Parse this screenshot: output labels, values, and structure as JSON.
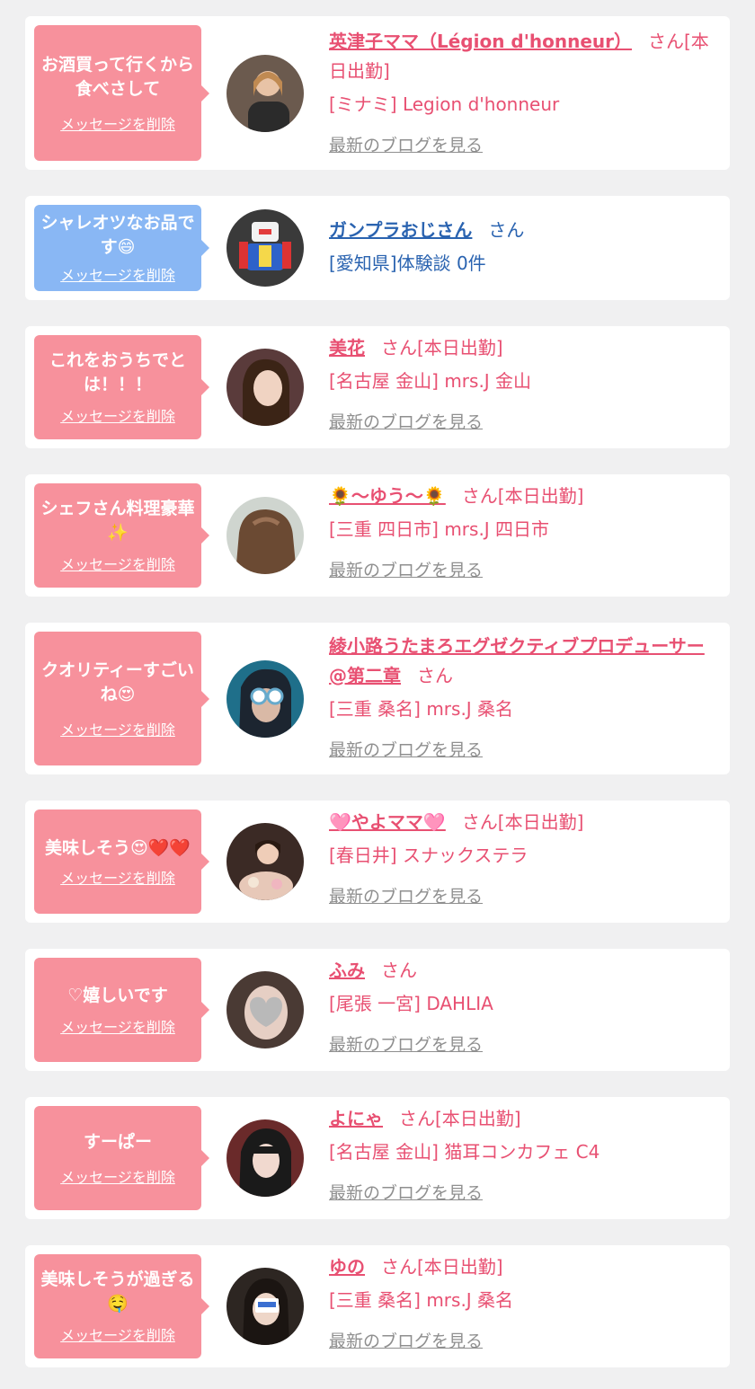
{
  "colors": {
    "pink": "#f7919c",
    "blue": "#89b7f4",
    "name_pink": "#e85072",
    "name_blue": "#2a63b0",
    "blog_gray": "#8f8f8f"
  },
  "delete_label": "メッセージを削除",
  "blog_label": "最新のブログを見る",
  "entries": [
    {
      "message": "お酒買って行くから食べさして",
      "name": "英津子ママ（Légion d'honneur）",
      "suffix": "さん[本日出勤]",
      "shop": "[ミナミ] Legion d'honneur",
      "bubble": "pink"
    },
    {
      "message": "シャレオツなお品です😄",
      "name": "ガンプラおじさん",
      "suffix": "さん",
      "shop": "[愛知県]体験談 0件",
      "bubble": "blue"
    },
    {
      "message": "これをおうちでとは！！！",
      "name": "美花",
      "suffix": "さん[本日出勤]",
      "shop": "[名古屋 金山] mrs.J 金山",
      "bubble": "pink"
    },
    {
      "message": "シェフさん料理豪華✨",
      "name": "🌻～ゆう～🌻",
      "suffix": "さん[本日出勤]",
      "shop": "[三重 四日市] mrs.J 四日市",
      "bubble": "pink"
    },
    {
      "message": "クオリティーすごいね😍",
      "name": "綾小路うたまろエグゼクティブプロデューサー@第二章",
      "suffix": "さん",
      "shop": "[三重 桑名] mrs.J 桑名",
      "bubble": "pink"
    },
    {
      "message": "美味しそう😍❤️❤️",
      "name": "🩷やよママ🩷",
      "suffix": "さん[本日出勤]",
      "shop": "[春日井] スナックステラ",
      "bubble": "pink"
    },
    {
      "message": "♡嬉しいです",
      "name": "ふみ",
      "suffix": "さん",
      "shop": "[尾張 一宮] DAHLIA",
      "bubble": "pink"
    },
    {
      "message": "すーぱー",
      "name": "よにゃ",
      "suffix": "さん[本日出勤]",
      "shop": "[名古屋 金山] 猫耳コンカフェ C4",
      "bubble": "pink"
    },
    {
      "message": "美味しそうが過ぎる🤤",
      "name": "ゆの",
      "suffix": "さん[本日出勤]",
      "shop": "[三重 桑名] mrs.J 桑名",
      "bubble": "pink"
    }
  ]
}
